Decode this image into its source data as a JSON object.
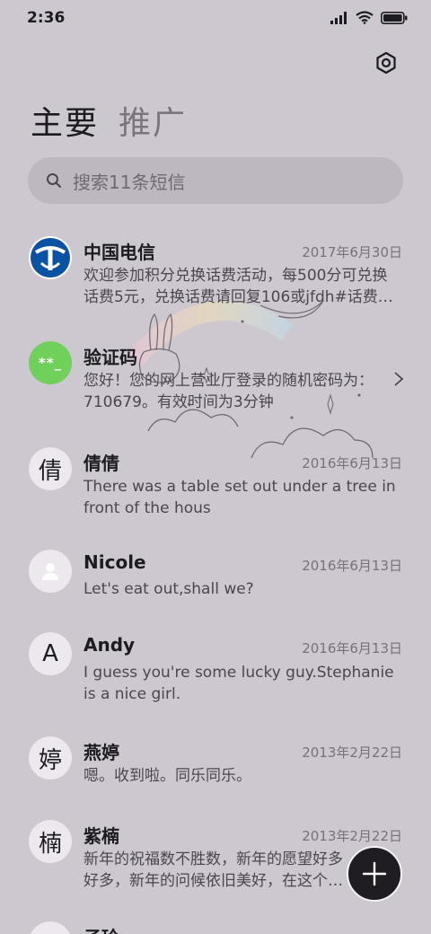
{
  "status_bar": {
    "time": "2:36"
  },
  "tabs": [
    {
      "label": "主要",
      "active": true
    },
    {
      "label": "推广",
      "active": false
    }
  ],
  "search": {
    "placeholder": "搜索11条短信"
  },
  "conversations": [
    {
      "name": "中国电信",
      "date": "2017年6月30日",
      "preview": "欢迎参加积分兑换话费活动，每500分可兑换话费5元，兑换话费请回复106或jfdh#话费…",
      "avatar_type": "telecom-logo"
    },
    {
      "name": "验证码",
      "date": "",
      "preview": "您好！您的网上营业厅登录的随机密码为：710679。有效时间为3分钟",
      "avatar_text": "**_",
      "avatar_type": "green"
    },
    {
      "name": "倩倩",
      "date": "2016年6月13日",
      "preview": "There was a table set out under a tree in front of the hous",
      "avatar_text": "倩"
    },
    {
      "name": "Nicole",
      "date": "2016年6月13日",
      "preview": "Let's eat out,shall we?",
      "avatar_type": "person-icon"
    },
    {
      "name": "Andy",
      "date": "2016年6月13日",
      "preview": "I guess you're some lucky guy.Stephanie is a nice girl.",
      "avatar_text": "A"
    },
    {
      "name": "燕婷",
      "date": "2013年2月22日",
      "preview": "嗯。收到啦。同乐同乐。",
      "avatar_text": "婷"
    },
    {
      "name": "紫楠",
      "date": "2013年2月22日",
      "preview": "新年的祝福数不胜数，新年的愿望好多好多，新年的问候依旧美好，在这个温馨的时刻…",
      "avatar_text": "楠"
    },
    {
      "name": "子玲",
      "date": "",
      "preview": "",
      "avatar_text": ""
    }
  ],
  "colors": {
    "background": "#cdc7d0",
    "fab": "#1f1d22",
    "verification_avatar": "#6fd05a",
    "telecom_blue": "#0a52a3"
  }
}
